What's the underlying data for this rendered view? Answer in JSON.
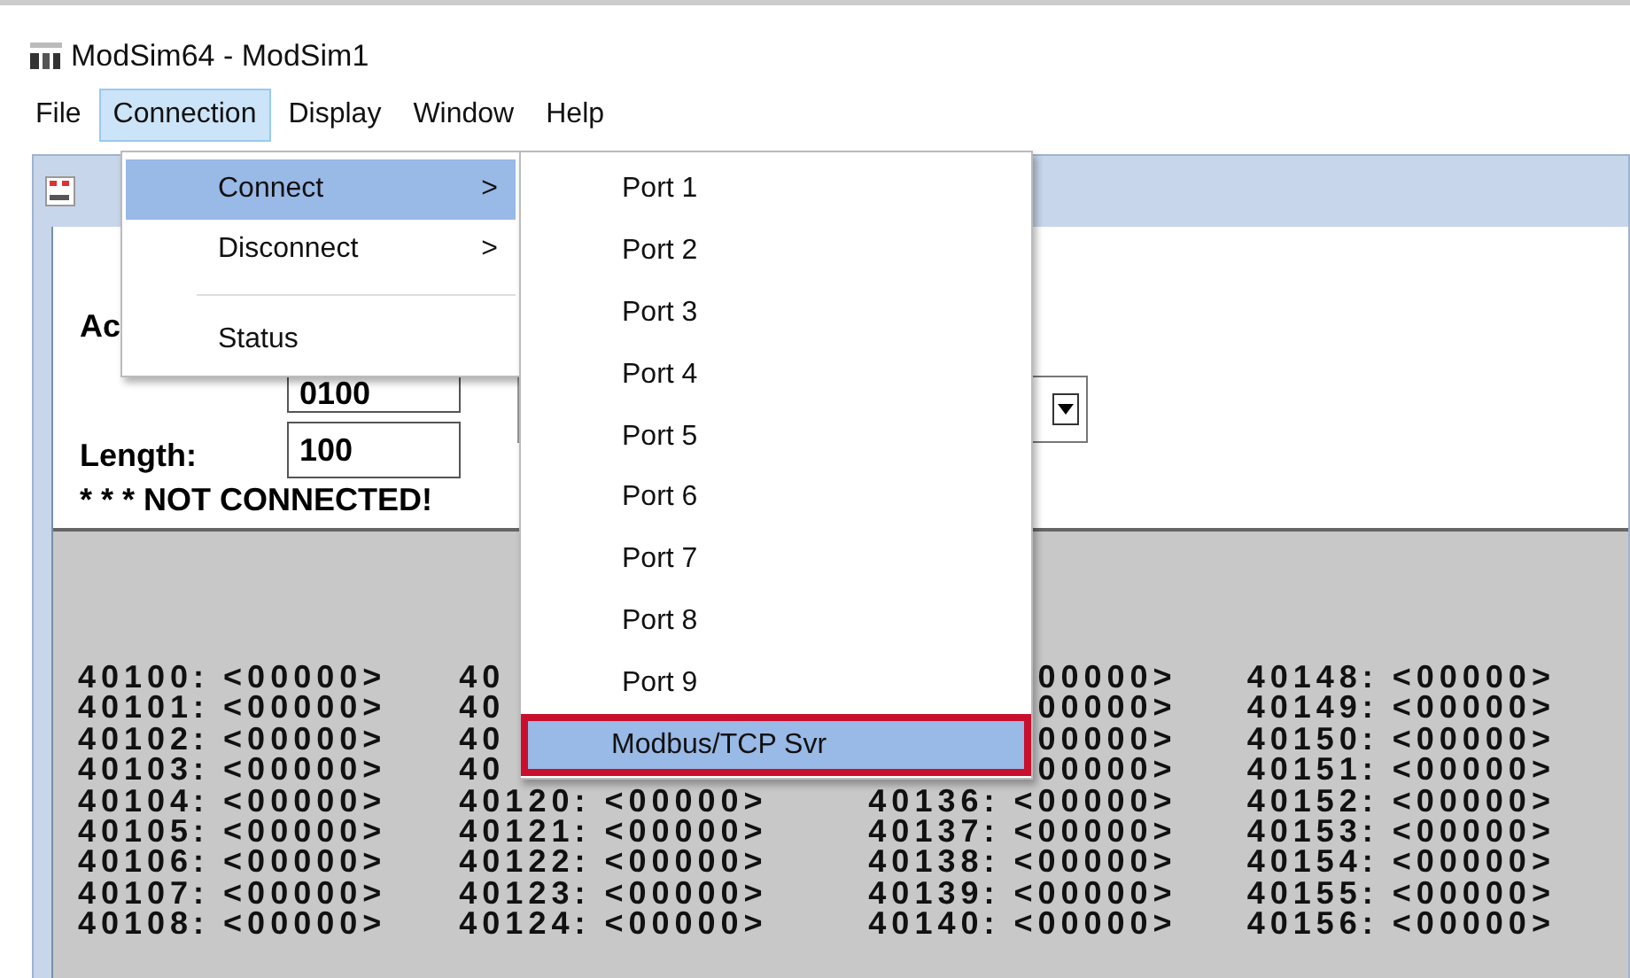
{
  "window": {
    "title": "ModSim64 - ModSim1"
  },
  "menu_bar": [
    {
      "label": "File",
      "selected": false
    },
    {
      "label": "Connection",
      "selected": true
    },
    {
      "label": "Display",
      "selected": false
    },
    {
      "label": "Window",
      "selected": false
    },
    {
      "label": "Help",
      "selected": false
    }
  ],
  "connection_menu": [
    {
      "kind": "submenu",
      "label": "Connect",
      "selected": true,
      "arrow": ">"
    },
    {
      "kind": "submenu",
      "label": "Disconnect",
      "selected": false,
      "arrow": ">"
    },
    {
      "kind": "separator"
    },
    {
      "kind": "item",
      "label": "Status",
      "selected": false
    }
  ],
  "connect_submenu": [
    {
      "label": "Port 1",
      "selected": false,
      "outlined": false
    },
    {
      "label": "Port 2",
      "selected": false,
      "outlined": false
    },
    {
      "label": "Port 3",
      "selected": false,
      "outlined": false
    },
    {
      "label": "Port 4",
      "selected": false,
      "outlined": false
    },
    {
      "label": "Port 5",
      "selected": false,
      "outlined": false
    },
    {
      "label": "Port 6",
      "selected": false,
      "outlined": false
    },
    {
      "label": "Port 7",
      "selected": false,
      "outlined": false
    },
    {
      "label": "Port 8",
      "selected": false,
      "outlined": false
    },
    {
      "label": "Port 9",
      "selected": false,
      "outlined": false
    },
    {
      "label": "Modbus/TCP Svr",
      "selected": true,
      "outlined": true
    }
  ],
  "form": {
    "address_label": "Ac",
    "address_value": "0100",
    "length_label": "Length:",
    "length_value": "100",
    "status_text": "* * * NOT CONNECTED!"
  },
  "registers": {
    "columns": [
      [
        "40100: <00000>",
        "40101: <00000>",
        "40102: <00000>",
        "40103: <00000>",
        "40104: <00000>",
        "40105: <00000>",
        "40106: <00000>",
        "40107: <00000>",
        "40108: <00000>"
      ],
      [
        "40",
        "40",
        "40",
        "40",
        "40120: <00000>",
        "40121: <00000>",
        "40122: <00000>",
        "40123: <00000>",
        "40124: <00000>"
      ],
      [
        "00000>",
        "00000>",
        "00000>",
        "00000>",
        "40136: <00000>",
        "40137: <00000>",
        "40138: <00000>",
        "40139: <00000>",
        "40140: <00000>"
      ],
      [
        "40148: <00000>",
        "40149: <00000>",
        "40150: <00000>",
        "40151: <00000>",
        "40152: <00000>",
        "40153: <00000>",
        "40154: <00000>",
        "40155: <00000>",
        "40156: <00000>"
      ]
    ]
  }
}
